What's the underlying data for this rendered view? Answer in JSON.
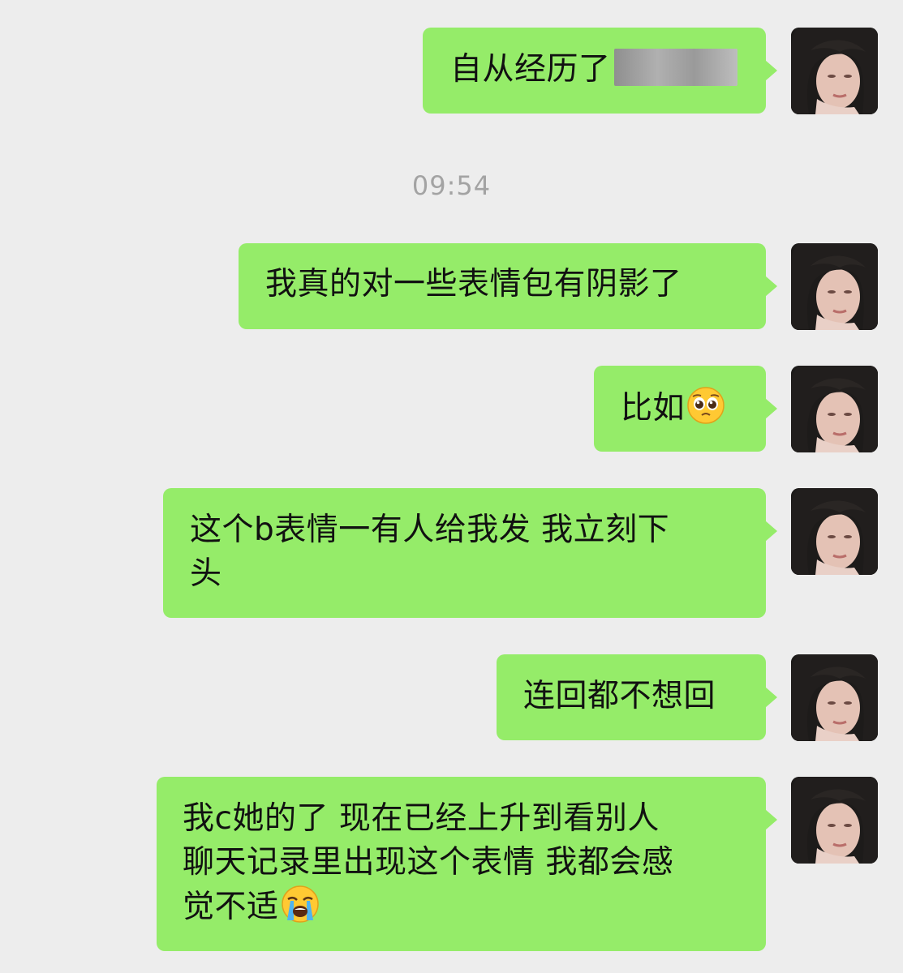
{
  "timestamp": "09:54",
  "messages": [
    {
      "text": "自从经历了",
      "redacted": true
    },
    {
      "text": "我真的对一些表情包有阴影了"
    },
    {
      "text": "比如",
      "emoji": "pleading-face-emoji"
    },
    {
      "lines": [
        "这个b表情一有人给我发 我立刻下",
        "头"
      ]
    },
    {
      "text": "连回都不想回"
    },
    {
      "lines": [
        "我c她的了 现在已经上升到看别人",
        "聊天记录里出现这个表情 我都会感",
        "觉不适"
      ],
      "emoji": "loudly-crying-face-emoji"
    }
  ],
  "colors": {
    "background": "#ededed",
    "bubble": "#95ec69",
    "text": "#111111",
    "timestamp": "#a3a3a3"
  }
}
